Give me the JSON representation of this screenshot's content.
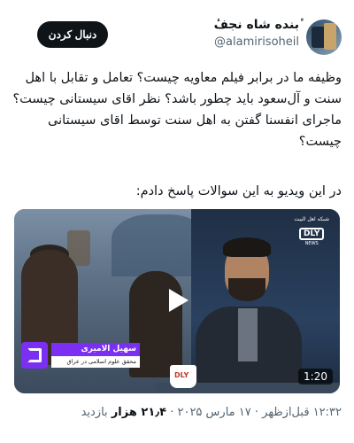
{
  "author": {
    "display_name": "ٔبنده شاه نجفٔ",
    "handle": "@alamirisoheil",
    "avatar_icon": "profile-avatar"
  },
  "follow_button": {
    "label": "دنبال کردن"
  },
  "tweet": {
    "text": "وظیفه ما در برابر فیلم معاویه چیست؟ تعامل و تقابل با اهل\nسنت و آل‌سعود باید چطور باشد؟ نظر اقای سیستانی چیست؟\nماجرای انفسنا گفتن به اهل سنت توسط اقای سیستانی\nچیست؟",
    "text2": "در این ویدیو به این سوالات پاسخ دادم:"
  },
  "video": {
    "duration": "1:20",
    "play_icon": "play-icon",
    "channel": {
      "top_text": "شبکه اهل البیت",
      "box_text": "DLY",
      "news_text": "NEWS"
    },
    "lower_third": {
      "name": "سهیل الامیری",
      "title": "محقق علوم اسلامی در عراق"
    },
    "mug_logo": "DLY"
  },
  "meta": {
    "time": "۱۲:۳۲ قبل‌ازظهر",
    "separator": "·",
    "date": "۱۷ مارس ۲۰۲۵",
    "views_count": "۲۱٫۴ هزار",
    "views_label": "بازدید"
  },
  "colors": {
    "text": "#0f1419",
    "secondary": "#536471",
    "follow_bg": "#0f1419",
    "accent_purple": "#7b2ff2"
  }
}
